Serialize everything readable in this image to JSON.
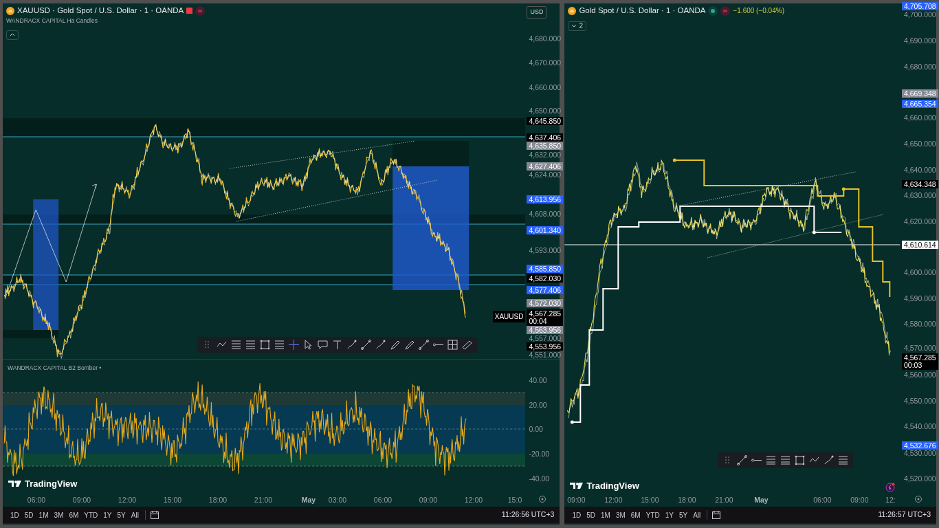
{
  "left_chart": {
    "title": "XAUUSD · Gold Spot / U.S. Dollar · 1 · OANDA",
    "indicator": "WANDRACX CAPITAL Ha Candles",
    "currency": "USD",
    "symbol_tag": "XAUUSD",
    "price_labels": [
      {
        "kind": "tick",
        "text": "4,680.000"
      },
      {
        "kind": "tick",
        "text": "4,670.000"
      },
      {
        "kind": "tick",
        "text": "4,660.000"
      },
      {
        "kind": "tick",
        "text": "4,650.000"
      },
      {
        "kind": "badge",
        "text": "4,645.850",
        "color": "#000000"
      },
      {
        "kind": "badge",
        "text": "4,637.406",
        "color": "#000000"
      },
      {
        "kind": "badge",
        "text": "4,635.850",
        "color": "#868993"
      },
      {
        "kind": "tick",
        "text": "4,632.000"
      },
      {
        "kind": "badge",
        "text": "4,627.406",
        "color": "#868993"
      },
      {
        "kind": "tick",
        "text": "4,624.000"
      },
      {
        "kind": "badge",
        "text": "4,613.956",
        "color": "#2962ff"
      },
      {
        "kind": "tick",
        "text": "4,608.000"
      },
      {
        "kind": "badge",
        "text": "4,601.340",
        "color": "#2962ff"
      },
      {
        "kind": "tick",
        "text": "4,593.000"
      },
      {
        "kind": "badge",
        "text": "4,585.850",
        "color": "#2962ff"
      },
      {
        "kind": "badge",
        "text": "4,582.030",
        "color": "#000000"
      },
      {
        "kind": "badge",
        "text": "4,577.406",
        "color": "#2962ff"
      },
      {
        "kind": "badge",
        "text": "4,572.030",
        "color": "#868993"
      },
      {
        "kind": "last",
        "text": "4,567.285",
        "countdown": "00:04",
        "color": "#000000"
      },
      {
        "kind": "badge",
        "text": "4,563.956",
        "color": "#868993"
      },
      {
        "kind": "tick",
        "text": "4,557.000"
      },
      {
        "kind": "badge",
        "text": "4,553.956",
        "color": "#000000"
      },
      {
        "kind": "tick",
        "text": "4,551.000"
      }
    ],
    "oscillator": {
      "title": "WANDRACX CAPITAL B2 Bomber •",
      "axis_labels": [
        "40.00",
        "20.00",
        "0.00",
        "-20.00",
        "-40.00"
      ]
    },
    "time_labels": [
      {
        "text": "06:00"
      },
      {
        "text": "09:00"
      },
      {
        "text": "12:00"
      },
      {
        "text": "15:00"
      },
      {
        "text": "18:00"
      },
      {
        "text": "21:00"
      },
      {
        "text": "May",
        "kind": "month"
      },
      {
        "text": "03:00"
      },
      {
        "text": "06:00"
      },
      {
        "text": "09:00"
      },
      {
        "text": "12:00"
      },
      {
        "text": "15:0"
      }
    ],
    "logo": "TradingView",
    "ranges": [
      "1D",
      "5D",
      "1M",
      "3M",
      "6M",
      "YTD",
      "1Y",
      "5Y",
      "All"
    ],
    "clock": "11:26:56 UTC+3"
  },
  "right_chart": {
    "title": "Gold Spot / U.S. Dollar · 1 · OANDA",
    "change": "−1.600 (−0.04%)",
    "collapsed_count": "2",
    "price_labels": [
      {
        "kind": "badge",
        "text": "4,705.708",
        "color": "#2962ff"
      },
      {
        "kind": "tick",
        "text": "4,700.000"
      },
      {
        "kind": "tick",
        "text": "4,690.000"
      },
      {
        "kind": "tick",
        "text": "4,680.000"
      },
      {
        "kind": "badge",
        "text": "4,669.348",
        "color": "#868993"
      },
      {
        "kind": "badge",
        "text": "4,665.354",
        "color": "#2962ff"
      },
      {
        "kind": "tick",
        "text": "4,660.000"
      },
      {
        "kind": "tick",
        "text": "4,650.000"
      },
      {
        "kind": "tick",
        "text": "4,640.000"
      },
      {
        "kind": "badge",
        "text": "4,634.348",
        "color": "#000000"
      },
      {
        "kind": "tick",
        "text": "4,630.000"
      },
      {
        "kind": "tick",
        "text": "4,620.000"
      },
      {
        "kind": "badge",
        "text": "4,610.614",
        "color": "#ffffff"
      },
      {
        "kind": "tick",
        "text": "4,600.000"
      },
      {
        "kind": "tick",
        "text": "4,590.000"
      },
      {
        "kind": "tick",
        "text": "4,580.000"
      },
      {
        "kind": "tick",
        "text": "4,570.000"
      },
      {
        "kind": "last",
        "text": "4,567.285",
        "countdown": "00:03",
        "color": "#000000"
      },
      {
        "kind": "tick",
        "text": "4,560.000"
      },
      {
        "kind": "tick",
        "text": "4,550.000"
      },
      {
        "kind": "tick",
        "text": "4,540.000"
      },
      {
        "kind": "badge",
        "text": "4,532.676",
        "color": "#2962ff"
      },
      {
        "kind": "tick",
        "text": "4,530.000"
      },
      {
        "kind": "tick",
        "text": "4,520.000"
      }
    ],
    "time_labels": [
      {
        "text": "09:00"
      },
      {
        "text": "12:00"
      },
      {
        "text": "15:00"
      },
      {
        "text": "18:00"
      },
      {
        "text": "21:00"
      },
      {
        "text": "May",
        "kind": "month"
      },
      {
        "text": "06:00"
      },
      {
        "text": "09:00"
      },
      {
        "text": "12:"
      }
    ],
    "logo": "TradingView",
    "ranges": [
      "1D",
      "5D",
      "1M",
      "3M",
      "6M",
      "YTD",
      "1Y",
      "5Y",
      "All"
    ],
    "clock": "11:26:57 UTC+3"
  }
}
